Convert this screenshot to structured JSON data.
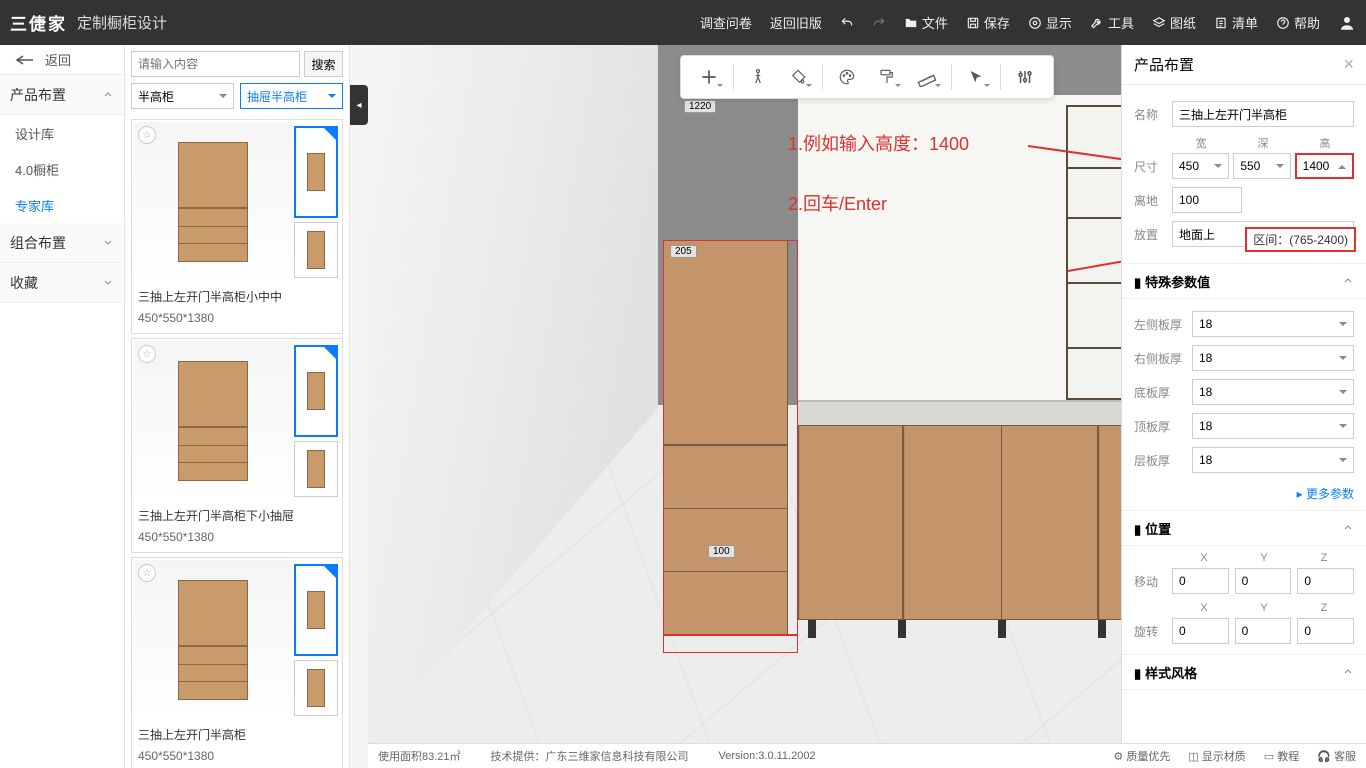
{
  "app": {
    "logo": "三倢家",
    "title": "定制橱柜设计"
  },
  "topmenu": [
    "调查问卷",
    "返回旧版"
  ],
  "topactions": {
    "file": "文件",
    "save": "保存",
    "display": "显示",
    "tool": "工具",
    "drawing": "图纸",
    "list": "清单",
    "help": "帮助"
  },
  "leftnav": {
    "back": "返回",
    "sections": [
      {
        "title": "产品布置",
        "open": true,
        "items": [
          {
            "label": "设计库",
            "active": false
          },
          {
            "label": "4.0橱柜",
            "active": false
          },
          {
            "label": "专家库",
            "active": true
          }
        ]
      },
      {
        "title": "组合布置",
        "open": false
      },
      {
        "title": "收藏",
        "open": false
      }
    ]
  },
  "search": {
    "placeholder": "请输入内容",
    "btn": "搜索"
  },
  "filters": {
    "a": "半高柜",
    "b": "抽屉半高柜"
  },
  "products": [
    {
      "name": "三抽上左开门半高柜小中中",
      "dim": "450*550*1380"
    },
    {
      "name": "三抽上左开门半高柜下小抽屉",
      "dim": "450*550*1380"
    },
    {
      "name": "三抽上左开门半高柜",
      "dim": "450*550*1380"
    }
  ],
  "scene_dims": {
    "top": "1220",
    "sel": "205",
    "drawer": "100"
  },
  "annotations": {
    "a1": "1.例如输入高度：1400",
    "a2": "2.回车/Enter",
    "range_label": "区间"
  },
  "panel": {
    "title": "产品布置",
    "name_lbl": "名称",
    "name": "三抽上左开门半高柜",
    "dim_lbl": "尺寸",
    "w_lbl": "宽",
    "d_lbl": "深",
    "h_lbl": "高",
    "w": "450",
    "d": "550",
    "h": "1400",
    "ground_lbl": "离地",
    "ground": "100",
    "range": "区间：(765-2400)",
    "place_lbl": "放置",
    "place": "地面上",
    "acc1": "特殊参数值",
    "params": [
      {
        "lbl": "左侧板厚",
        "v": "18"
      },
      {
        "lbl": "右侧板厚",
        "v": "18"
      },
      {
        "lbl": "底板厚",
        "v": "18"
      },
      {
        "lbl": "顶板厚",
        "v": "18"
      },
      {
        "lbl": "层板厚",
        "v": "18"
      }
    ],
    "more": "▸ 更多参数",
    "acc2": "位置",
    "move_lbl": "移动",
    "rot_lbl": "旋转",
    "xyz": {
      "x": "X",
      "y": "Y",
      "z": "Z"
    },
    "move": [
      "0",
      "0",
      "0"
    ],
    "rot": [
      "0",
      "0",
      "0"
    ],
    "acc3": "样式风格"
  },
  "status": {
    "area": "使用面积83.21㎡",
    "tech": "技术提供：广东三维家信息科技有限公司",
    "ver": "Version:3.0.11.2002",
    "r": [
      "质量优先",
      "显示材质",
      "教程",
      "客服"
    ]
  }
}
